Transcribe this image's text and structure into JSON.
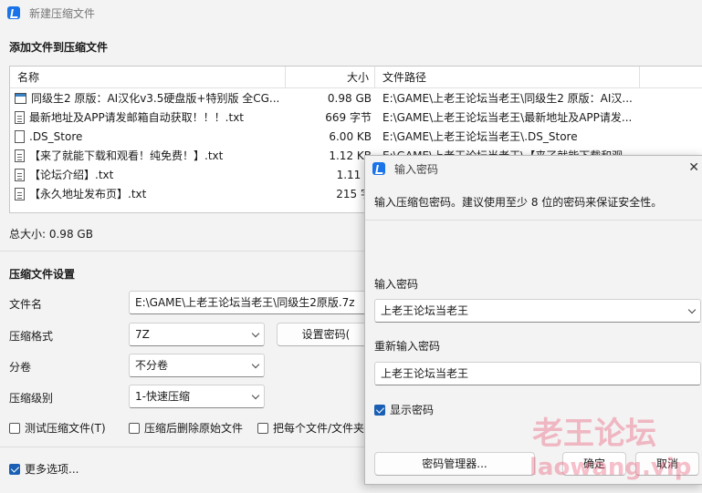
{
  "window": {
    "title": "新建压缩文件"
  },
  "add_section_title": "添加文件到压缩文件",
  "file_list": {
    "headers": {
      "name": "名称",
      "size": "大小",
      "path": "文件路径"
    },
    "rows": [
      {
        "icon": "iso",
        "name": "同级生2 原版：AI汉化v3.5硬盘版+特别版 全CG...",
        "size": "0.98 GB",
        "path": "E:\\GAME\\上老王论坛当老王\\同级生2 原版：AI汉..."
      },
      {
        "icon": "txt",
        "name": "最新地址及APP请发邮箱自动获取！！！.txt",
        "size": "669 字节",
        "path": "E:\\GAME\\上老王论坛当老王\\最新地址及APP请发..."
      },
      {
        "icon": "file",
        "name": ".DS_Store",
        "size": "6.00 KB",
        "path": "E:\\GAME\\上老王论坛当老王\\.DS_Store"
      },
      {
        "icon": "txt",
        "name": "【来了就能下载和观看！纯免费！】.txt",
        "size": "1.12 KB",
        "path": "E:\\GAME\\上老王论坛当老王\\【来了就能下载和观"
      },
      {
        "icon": "txt",
        "name": "【论坛介绍】.txt",
        "size": "1.11 K",
        "path": ""
      },
      {
        "icon": "txt",
        "name": "【永久地址发布页】.txt",
        "size": "215 字",
        "path": ""
      }
    ]
  },
  "total_size": "总大小: 0.98 GB",
  "settings": {
    "title": "压缩文件设置",
    "filename_label": "文件名",
    "filename_value": "E:\\GAME\\上老王论坛当老王\\同级生2原版.7z",
    "format_label": "压缩格式",
    "format_value": "7Z",
    "set_password_button": "设置密码(",
    "split_label": "分卷",
    "split_value": "不分卷",
    "level_label": "压缩级别",
    "level_value": "1-快速压缩",
    "test_check": "测试压缩文件(T)",
    "delete_check": "压缩后删除原始文件",
    "each_check": "把每个文件/文件夹",
    "more_options": "更多选项..."
  },
  "password_dialog": {
    "title": "输入密码",
    "description": "输入压缩包密码。建议使用至少 8 位的密码来保证安全性。",
    "password_label": "输入密码",
    "password_value": "上老王论坛当老王",
    "reenter_label": "重新输入密码",
    "reenter_value": "上老王论坛当老王",
    "show_password": "显示密码",
    "manager_button": "密码管理器...",
    "ok_button": "确定",
    "cancel_button": "取消"
  },
  "watermark": {
    "line1": "老王论坛",
    "line2": "laowang.vip"
  },
  "colors": {
    "accent": "#1a5fb4",
    "watermark": "#e84b6a"
  }
}
